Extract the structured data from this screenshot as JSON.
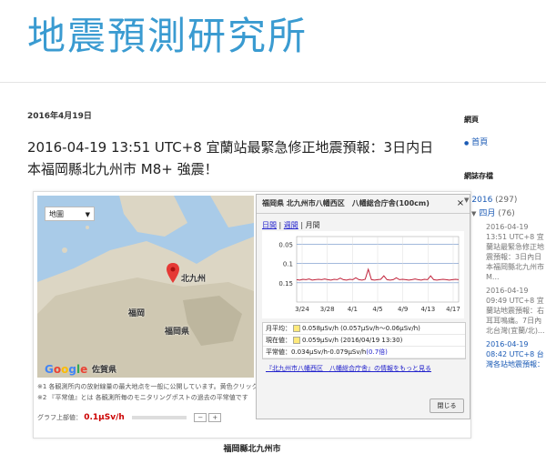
{
  "blog": {
    "title": "地震預測研究所"
  },
  "post": {
    "date": "2016年4月19日",
    "title": "2016-04-19 13:51 UTC+8 宜蘭站最緊急修正地震預報：3日内日本福岡縣北九州市 M8+ 強震！",
    "caption": "福岡縣北九州市"
  },
  "map": {
    "type_select": "地圖",
    "labels": {
      "kitakyushu": "北九州",
      "fukuoka": "福岡",
      "fukuoka_ken": "福岡県",
      "saga": "佐賀県"
    },
    "notes": [
      "※1 各観測所内の放射線量の最大地点を一般に公開しています。黄色クリックで測",
      "※2 『平常値』とは 各観測所毎のモニタリングポストの過去の平常値です"
    ],
    "graph_label": "グラフ上部値：",
    "graph_value": "0.1μSv/h",
    "minus": "−",
    "plus": "+"
  },
  "popup": {
    "title": "福岡県 北九州市八幡西区　八幡総合庁舎(100cm)",
    "close_x": "×",
    "tabs": {
      "day": "日間",
      "week": "週間",
      "month": "月間"
    },
    "tab_sep": "|",
    "y_ticks": [
      "0.15",
      "0.1",
      "0.05"
    ],
    "x_ticks": [
      "3/24",
      "3/28",
      "4/1",
      "4/5",
      "4/9",
      "4/13",
      "4/17"
    ],
    "stats": {
      "mean": "月平均：",
      "mean_val": "0.058μSv/h (0.057μSv/h〜0.06μSv/h)",
      "current": "現在値：",
      "current_val": "0.059μSv/h (2016/04/19 13:30)",
      "normal": "平常値：",
      "normal_val": "0.034μSv/h-0.079μSv/h",
      "normal_ref": "(0.7倍)"
    },
    "more": "『北九州市八幡西区　八幡総合庁舎』の情報をもっと見る",
    "close_btn": "閉じる"
  },
  "sidebar": {
    "pages_heading": "網頁",
    "home": "首頁",
    "archive_heading": "網誌存檔",
    "year": "2016",
    "year_count": "(297)",
    "month": "四月",
    "month_count": "(76)",
    "posts": [
      "2016-04-19 13:51 UTC+8 宜蘭站最緊急修正地震預報：3日內日本福岡縣北九州市 M...",
      "2016-04-19 09:49 UTC+8 宜蘭站地震預報：右耳耳鳴痛。7日內北台灣(宜蘭/北)...",
      "2016-04-19 08:42 UTC+8 台灣各站地震預報："
    ]
  },
  "chart_data": {
    "type": "line",
    "x": [
      "3/24",
      "3/28",
      "4/1",
      "4/5",
      "4/9",
      "4/13",
      "4/17"
    ],
    "ylim": [
      0,
      0.17
    ],
    "y_ticks": [
      0.05,
      0.1,
      0.15
    ],
    "grid": true,
    "series": [
      {
        "values": [
          0.058,
          0.057,
          0.059,
          0.058,
          0.06,
          0.057,
          0.058,
          0.059,
          0.058,
          0.06,
          0.058,
          0.057,
          0.059,
          0.058,
          0.062,
          0.058,
          0.057,
          0.059,
          0.058,
          0.063,
          0.058,
          0.057,
          0.059,
          0.085,
          0.058,
          0.057,
          0.058,
          0.059,
          0.068,
          0.058,
          0.057,
          0.058,
          0.063,
          0.058,
          0.059,
          0.058,
          0.057,
          0.058,
          0.06,
          0.058,
          0.057,
          0.059,
          0.058,
          0.068,
          0.058,
          0.057,
          0.058,
          0.059,
          0.058,
          0.057,
          0.058,
          0.059,
          0.058
        ]
      }
    ]
  }
}
